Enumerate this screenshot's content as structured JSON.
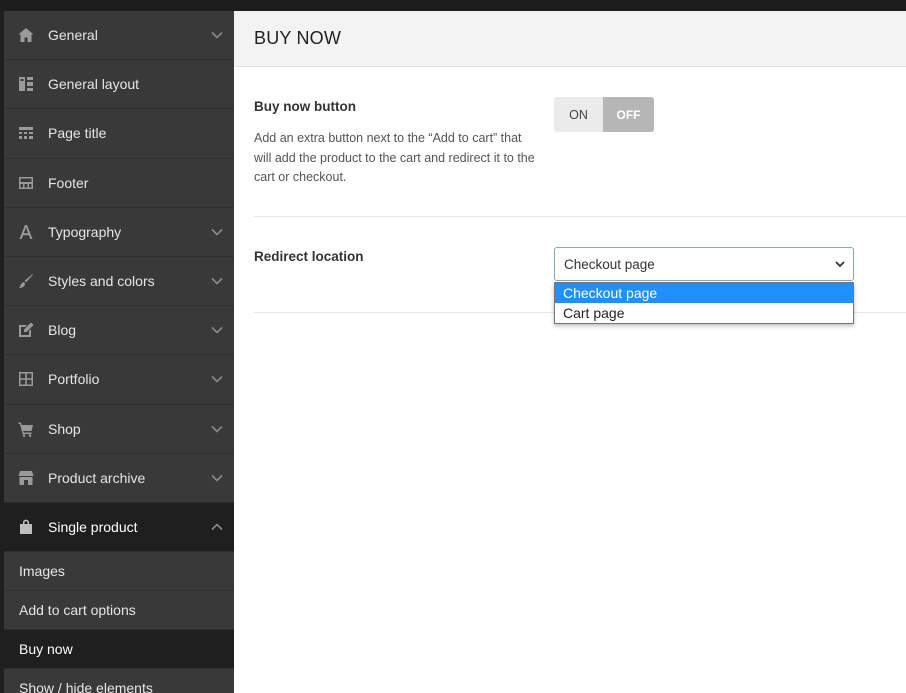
{
  "sidebar": {
    "items": [
      {
        "label": "General",
        "icon": "home-icon",
        "expandable": true
      },
      {
        "label": "General layout",
        "icon": "layout-icon",
        "expandable": false
      },
      {
        "label": "Page title",
        "icon": "page-title-icon",
        "expandable": false
      },
      {
        "label": "Footer",
        "icon": "footer-icon",
        "expandable": false
      },
      {
        "label": "Typography",
        "icon": "typography-icon",
        "expandable": true
      },
      {
        "label": "Styles and colors",
        "icon": "brush-icon",
        "expandable": true
      },
      {
        "label": "Blog",
        "icon": "edit-icon",
        "expandable": true
      },
      {
        "label": "Portfolio",
        "icon": "grid-icon",
        "expandable": true
      },
      {
        "label": "Shop",
        "icon": "cart-icon",
        "expandable": true
      },
      {
        "label": "Product archive",
        "icon": "store-icon",
        "expandable": true
      },
      {
        "label": "Single product",
        "icon": "bag-icon",
        "expandable": true,
        "expanded": true
      }
    ],
    "subitems": [
      {
        "label": "Images"
      },
      {
        "label": "Add to cart options"
      },
      {
        "label": "Buy now",
        "active": true
      },
      {
        "label": "Show / hide elements"
      }
    ]
  },
  "page": {
    "title": "BUY NOW"
  },
  "options": {
    "buy_now": {
      "title": "Buy now button",
      "description": "Add an extra button next to the “Add to cart” that will add the product to the cart and redirect it to the cart or checkout.",
      "on_label": "ON",
      "off_label": "OFF",
      "state": "OFF"
    },
    "redirect": {
      "title": "Redirect location",
      "selected": "Checkout page",
      "dropdown_open": true,
      "options": [
        "Checkout page",
        "Cart page"
      ]
    }
  },
  "colors": {
    "sidebar_bg": "#393939",
    "sidebar_active_bg": "#1f1f1f",
    "dropdown_highlight": "#1e90ff"
  }
}
